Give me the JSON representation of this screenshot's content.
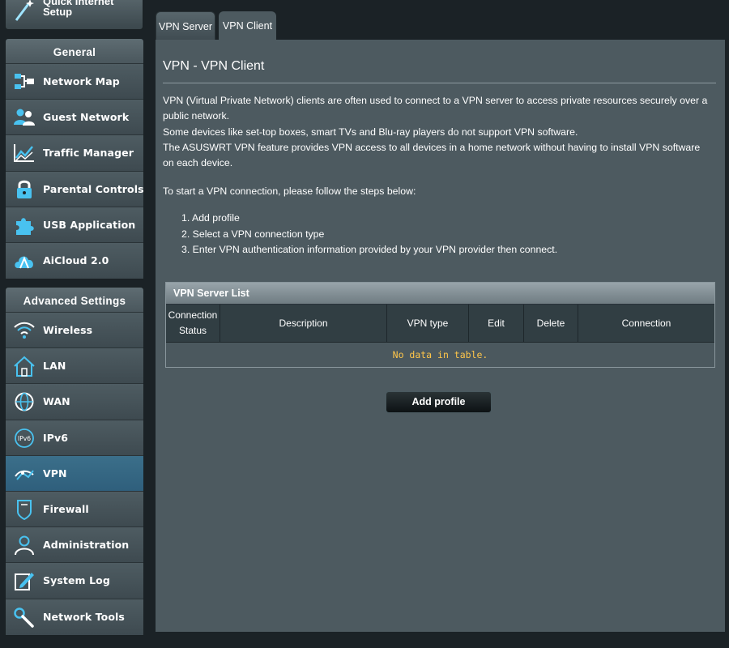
{
  "sidebar": {
    "quick_setup_label": "Quick Internet Setup",
    "general": {
      "header": "General",
      "items": [
        {
          "label": "Network Map",
          "icon": "network-map-icon"
        },
        {
          "label": "Guest Network",
          "icon": "guest-network-icon"
        },
        {
          "label": "Traffic Manager",
          "icon": "traffic-manager-icon"
        },
        {
          "label": "Parental Controls",
          "icon": "lock-icon"
        },
        {
          "label": "USB Application",
          "icon": "puzzle-icon"
        },
        {
          "label": "AiCloud 2.0",
          "icon": "cloud-icon"
        }
      ]
    },
    "advanced": {
      "header": "Advanced Settings",
      "items": [
        {
          "label": "Wireless",
          "icon": "wifi-icon"
        },
        {
          "label": "LAN",
          "icon": "home-icon"
        },
        {
          "label": "WAN",
          "icon": "globe-icon"
        },
        {
          "label": "IPv6",
          "icon": "ipv6-globe-icon",
          "icon_text": "IPv6"
        },
        {
          "label": "VPN",
          "icon": "vpn-icon",
          "active": true
        },
        {
          "label": "Firewall",
          "icon": "shield-icon"
        },
        {
          "label": "Administration",
          "icon": "user-icon"
        },
        {
          "label": "System Log",
          "icon": "edit-log-icon"
        },
        {
          "label": "Network Tools",
          "icon": "wrench-icon"
        }
      ]
    }
  },
  "tabs": [
    {
      "label": "VPN Server",
      "active": false
    },
    {
      "label": "VPN Client",
      "active": true
    }
  ],
  "main": {
    "title": "VPN - VPN Client",
    "description": [
      "VPN (Virtual Private Network) clients are often used to connect to a VPN server to access private resources securely over a public network.",
      "Some devices like set-top boxes, smart TVs and Blu-ray players do not support VPN software.",
      "The ASUSWRT VPN feature provides VPN access to all devices in a home network without having to install VPN software on each device."
    ],
    "steps_intro": "To start a VPN connection, please follow the steps below:",
    "steps": [
      "1. Add profile",
      "2. Select a VPN connection type",
      "3. Enter VPN authentication information provided by your VPN provider then connect."
    ],
    "table": {
      "title": "VPN Server List",
      "columns": [
        "Connection Status",
        "Description",
        "VPN type",
        "Edit",
        "Delete",
        "Connection"
      ],
      "empty_text": "No data in table."
    },
    "add_button": "Add profile"
  },
  "colors": {
    "panel": "#4d5a60",
    "background": "#1b2226",
    "empty_text": "#ffc64a",
    "active_menu": "#2f5f7c",
    "icon_accent": "#49c2f0"
  }
}
